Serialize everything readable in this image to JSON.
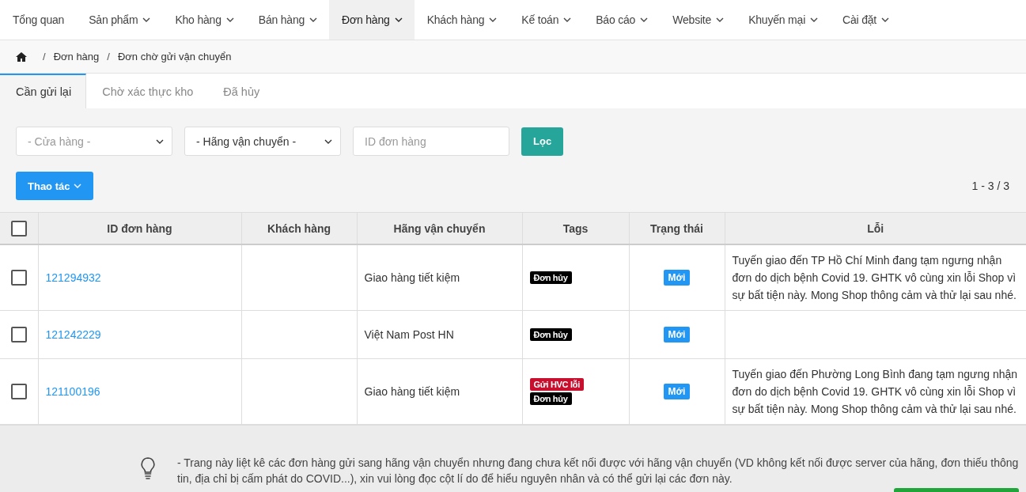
{
  "nav": {
    "items": [
      {
        "label": "Tổng quan",
        "dropdown": false,
        "selected": false
      },
      {
        "label": "Sản phẩm",
        "dropdown": true,
        "selected": false
      },
      {
        "label": "Kho hàng",
        "dropdown": true,
        "selected": false
      },
      {
        "label": "Bán hàng",
        "dropdown": true,
        "selected": false
      },
      {
        "label": "Đơn hàng",
        "dropdown": true,
        "selected": true
      },
      {
        "label": "Khách hàng",
        "dropdown": true,
        "selected": false
      },
      {
        "label": "Kế toán",
        "dropdown": true,
        "selected": false
      },
      {
        "label": "Báo cáo",
        "dropdown": true,
        "selected": false
      },
      {
        "label": "Website",
        "dropdown": true,
        "selected": false
      },
      {
        "label": "Khuyến mại",
        "dropdown": true,
        "selected": false
      },
      {
        "label": "Cài đặt",
        "dropdown": true,
        "selected": false
      }
    ]
  },
  "breadcrumb": [
    {
      "separator": "/",
      "label": "Đơn hàng"
    },
    {
      "separator": "/",
      "label": "Đơn chờ gửi vận chuyển"
    }
  ],
  "tabs": [
    {
      "label": "Cần gửi lại",
      "selected": true
    },
    {
      "label": "Chờ xác thực kho",
      "selected": false
    },
    {
      "label": "Đã hủy",
      "selected": false
    }
  ],
  "filters": {
    "store_select": {
      "placeholder": "- Cửa hàng -"
    },
    "carrier_select": {
      "value": "- Hãng vận chuyển -"
    },
    "order_id_field": {
      "placeholder": "ID đơn hàng"
    },
    "filter_button": "Lọc"
  },
  "actions_button": "Thao tác",
  "pagination": "1 - 3 / 3",
  "table": {
    "select_all_checked": false,
    "columns": [
      "ID đơn hàng",
      "Khách hàng",
      "Hãng vận chuyển",
      "Tags",
      "Trạng thái",
      "Lỗi"
    ],
    "rows": [
      {
        "checked": false,
        "id": "121294932",
        "carrier": "Giao hàng tiết kiệm",
        "tags": [
          {
            "label": "Đơn hủy",
            "color": "#000000"
          }
        ],
        "status": "Mới",
        "error": "Tuyến giao đến TP Hồ Chí Minh đang tạm ngưng nhận đơn do dịch bệnh Covid 19. GHTK vô cùng xin lỗi Shop vì sự bất tiện này. Mong Shop thông cảm và thử lại sau nhé."
      },
      {
        "checked": false,
        "id": "121242229",
        "carrier": "Việt Nam Post HN",
        "tags": [
          {
            "label": "Đơn hủy",
            "color": "#000000"
          }
        ],
        "status": "Mới"
      },
      {
        "checked": false,
        "id": "121100196",
        "carrier": "Giao hàng tiết kiệm",
        "tags": [
          {
            "label": "Gửi HVC lỗi",
            "color": "#c8102e"
          },
          {
            "label": "Đơn hủy",
            "color": "#000000"
          }
        ],
        "status": "Mới",
        "error": "Tuyến giao đến Phường Long Bình đang tạm ngưng nhận đơn do dịch bệnh Covid 19. GHTK vô cùng xin lỗi Shop vì sự bất tiện này. Mong Shop thông cảm và thử lại sau nhé."
      }
    ]
  },
  "note": "- Trang này liệt kê các đơn hàng gửi sang hãng vận chuyển nhưng đang chưa kết nối được với hãng vận chuyển (VD không kết nối được server của hãng, đơn thiếu thông tin, địa chỉ bị cấm phát do COVID...), xin vui lòng đọc cột lí do để hiểu nguyên nhân và có thể gửi lại các đơn này."
}
